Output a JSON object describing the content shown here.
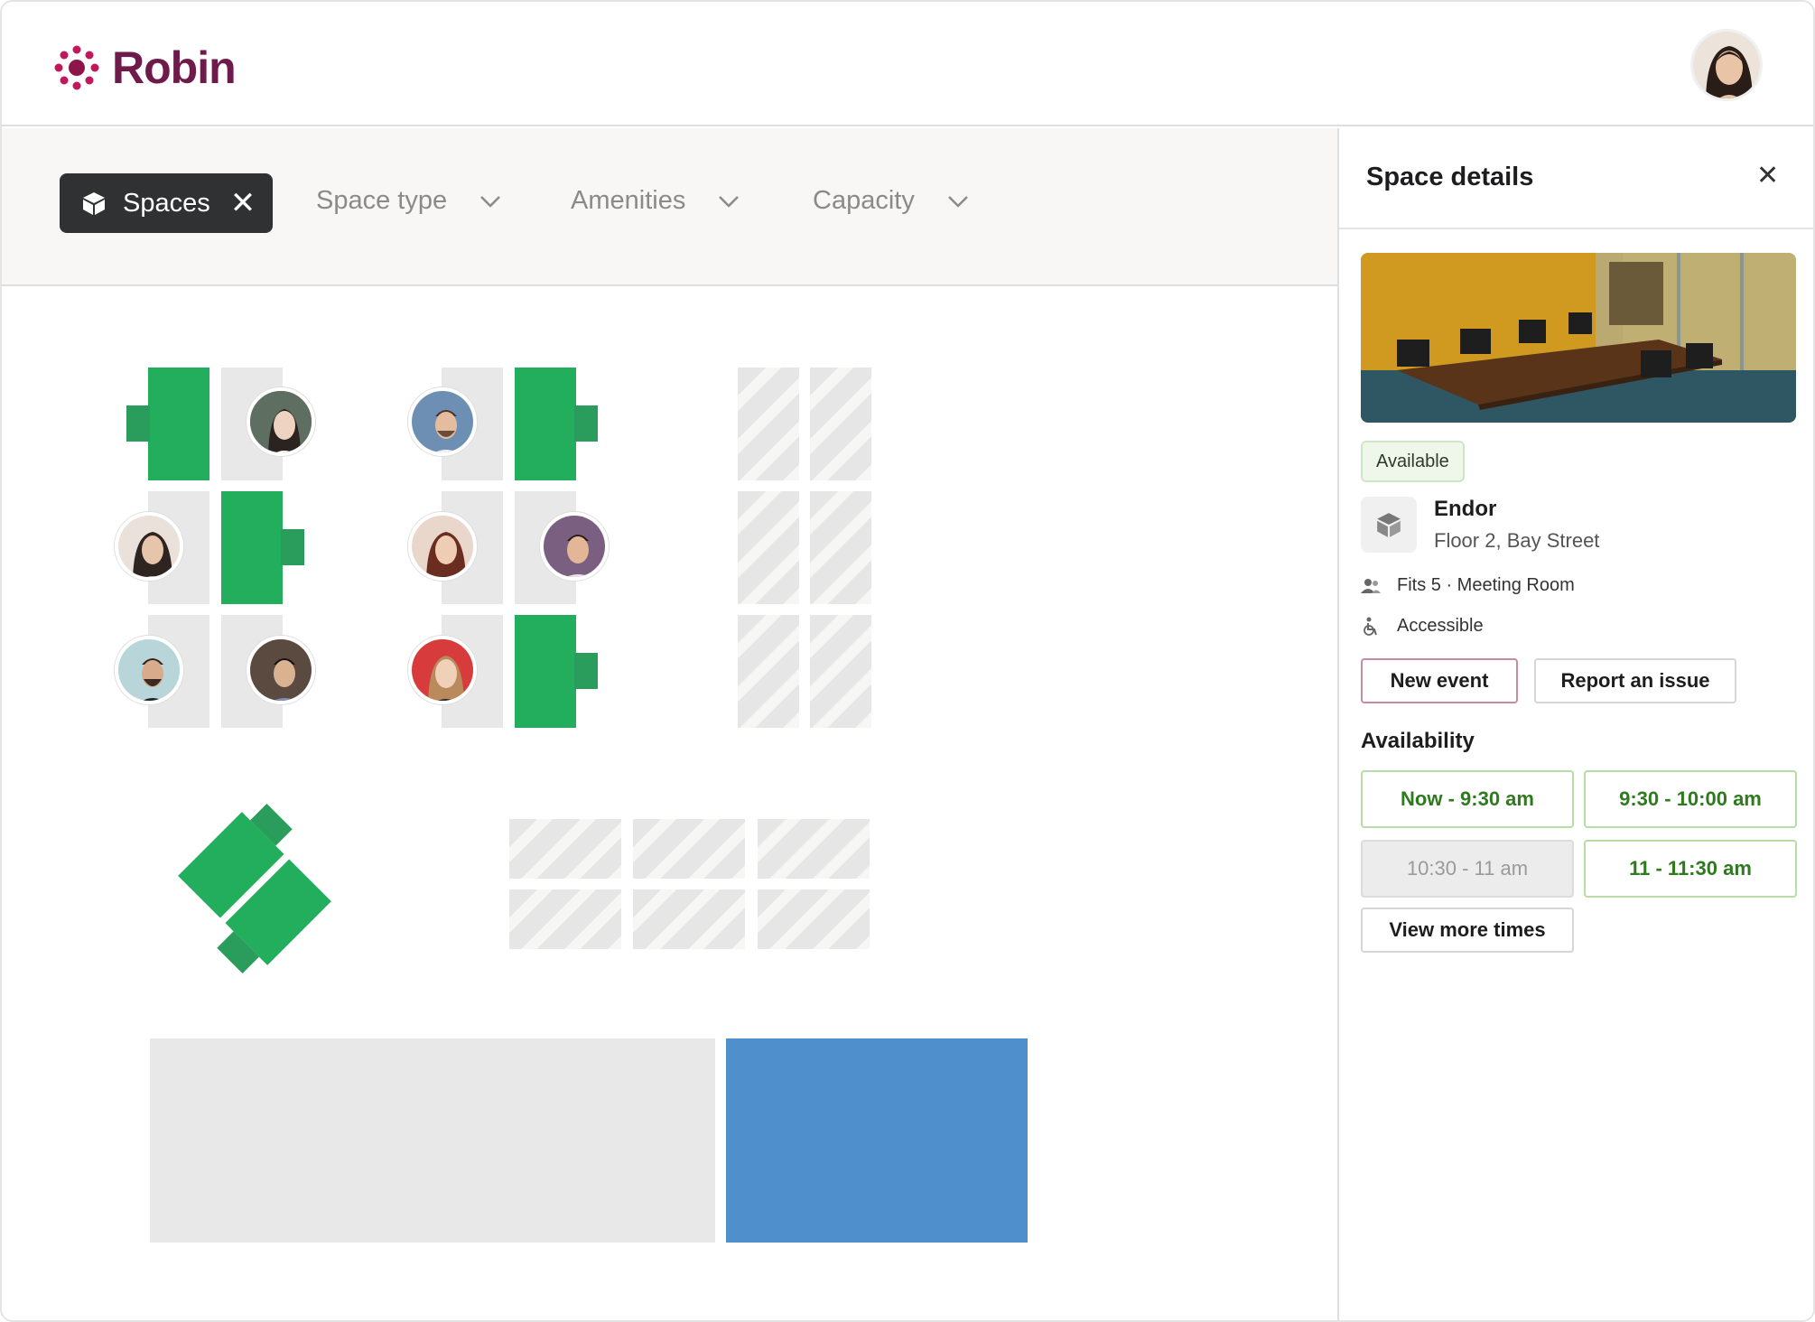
{
  "app": {
    "brand": "Robin"
  },
  "filters": {
    "active_chip": "Spaces",
    "dropdowns": [
      "Space type",
      "Amenities",
      "Capacity"
    ]
  },
  "panel": {
    "title": "Space details",
    "status": "Available",
    "room_name": "Endor",
    "room_location": "Floor 2, Bay Street",
    "capacity_text": "Fits 5 · Meeting Room",
    "accessibility_text": "Accessible",
    "new_event_label": "New event",
    "report_label": "Report an issue",
    "availability_heading": "Availability",
    "slots": [
      {
        "label": "Now - 9:30 am",
        "available": true
      },
      {
        "label": "9:30 - 10:00 am",
        "available": true
      },
      {
        "label": "10:30 - 11 am",
        "available": false
      },
      {
        "label": "11 - 11:30 am",
        "available": true
      }
    ],
    "view_more_label": "View more times"
  },
  "colors": {
    "brand": "#6e1a4a",
    "desk_green": "#22ae5c",
    "room_blue": "#4f90cc",
    "slot_green_text": "#2f7a1f",
    "new_event_border": "#c98aa3"
  },
  "icons": {
    "logo": "robin-dots-icon",
    "chip": "cube-icon",
    "capacity": "people-icon",
    "access": "wheelchair-icon"
  }
}
